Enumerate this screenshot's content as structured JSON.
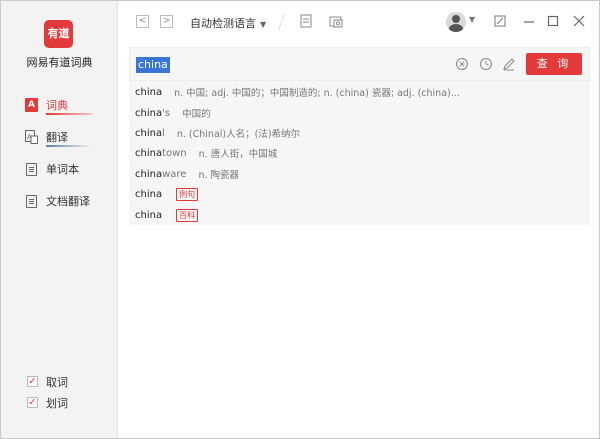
{
  "app": {
    "logo_text": "有道",
    "name": "网易有道词典"
  },
  "sidebar": {
    "items": [
      {
        "label": "词典",
        "icon": "dictionary-icon"
      },
      {
        "label": "翻译",
        "icon": "translate-icon"
      },
      {
        "label": "单词本",
        "icon": "wordbook-icon"
      },
      {
        "label": "文档翻译",
        "icon": "document-icon"
      }
    ],
    "options": [
      {
        "label": "取词",
        "checked": true
      },
      {
        "label": "划词",
        "checked": true
      }
    ]
  },
  "toolbar": {
    "back": "<",
    "forward": ">",
    "language": "自动检测语言"
  },
  "search": {
    "value": "china",
    "button": "查 询"
  },
  "suggestions": [
    {
      "word": "china",
      "rest": "",
      "def": "n. 中国; adj. 中国的；中国制造的; n. (china) 瓷器; adj. (china)...",
      "tag": ""
    },
    {
      "word": "china",
      "rest": "'s",
      "def": "中国的",
      "tag": ""
    },
    {
      "word": "china",
      "rest": "l",
      "def": "n. (Chinal)人名；(法)希纳尔",
      "tag": ""
    },
    {
      "word": "china",
      "rest": "town",
      "def": "n. 唐人街，中国城",
      "tag": ""
    },
    {
      "word": "china",
      "rest": "ware",
      "def": "n. 陶瓷器",
      "tag": ""
    },
    {
      "word": "china",
      "rest": "",
      "def": "",
      "tag": "例句"
    },
    {
      "word": "china",
      "rest": "",
      "def": "",
      "tag": "百科"
    }
  ],
  "colors": {
    "accent": "#e53a3a",
    "selection": "#3876d8",
    "sidebar_bg": "#f3f3f3"
  }
}
